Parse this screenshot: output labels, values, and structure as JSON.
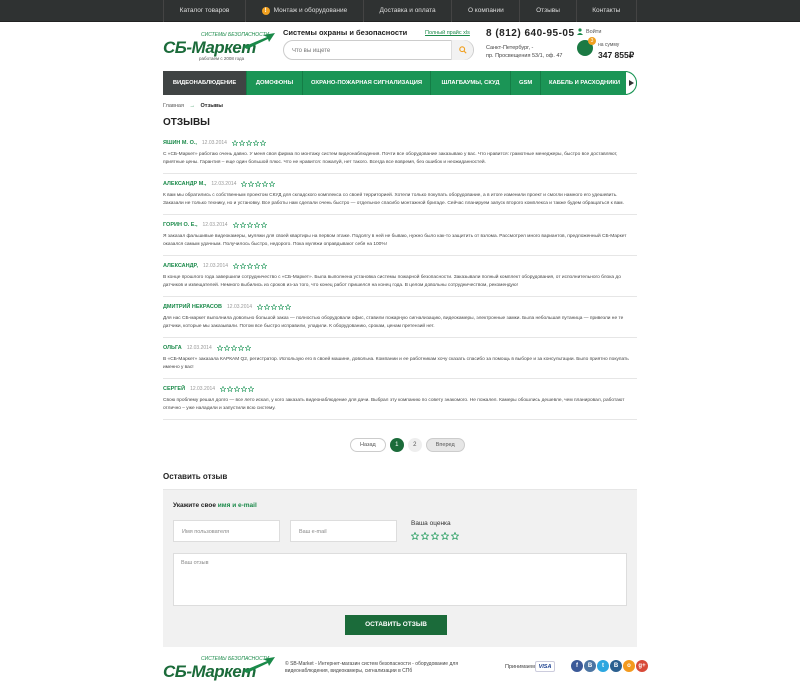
{
  "topnav": [
    {
      "label": "Каталог товаров",
      "icon": ""
    },
    {
      "label": "Монтаж и оборудование",
      "icon": "!"
    },
    {
      "label": "Доставка и оплата",
      "icon": ""
    },
    {
      "label": "О компании",
      "icon": ""
    },
    {
      "label": "Отзывы",
      "icon": ""
    },
    {
      "label": "Контакты",
      "icon": ""
    }
  ],
  "header": {
    "logo_main": "СБ-Маркет",
    "logo_top": "СИСТЕМЫ БЕЗОПАСНОСТИ",
    "logo_sub": "работаем с 2008 года",
    "tagline": "Системы охраны и безопасности",
    "price_link": "Полный прайс xls",
    "phone": "8 (812) 640-95-05",
    "address_line1": "Санкт-Петербург, -",
    "address_line2": "пр. Просвещения 53/1, оф. 47",
    "login": "Войти",
    "cart_label": "на сумму",
    "cart_sum": "347 855₽",
    "cart_count": "3"
  },
  "search": {
    "placeholder": "Что вы ищете"
  },
  "mainnav": [
    "ВИДЕОНАБЛЮДЕНИЕ",
    "ДОМОФОНЫ",
    "ОХРАНО-ПОЖАРНАЯ СИГНАЛИЗАЦИЯ",
    "ШЛАГБАУМЫ, СКУД",
    "GSM",
    "КАБЕЛЬ И РАСХОДНИКИ"
  ],
  "breadcrumb": {
    "home": "Главная",
    "sep": "→",
    "current": "Отзывы"
  },
  "page_title": "ОТЗЫВЫ",
  "reviews": [
    {
      "name": "ЯШИН М. О.,",
      "date": "12.03.2014",
      "text": "С «СБ-Маркет» работаю очень давно. У меня своя фирма по монтажу систем видеонаблюдения. Почти все оборудование заказываю у вас. Что нравится: грамотные менеджеры, быстро все доставляют, приятные цены. Гарантия – еще один большой плюс. Что не нравится: пожалуй, нет такого. Всегда все вовремя, без ошибок и неожиданностей."
    },
    {
      "name": "АЛЕКСАНДР М.,",
      "date": "12.03.2014",
      "text": "К вам мы обратились с собственным проектом СКУД для складского комплекса со своей территорией. Хотели только покупать оборудование, а в итоге изменили проект и смогли намного его удешевить. Заказали не только технику, но и установку. Все работы нам сделали очень быстро — отдельное спасибо монтажной бригаде. Сейчас планируем запуск второго комплекса и также будем обращаться к вам."
    },
    {
      "name": "ГОРИН О. Е.,",
      "date": "12.03.2014",
      "text": "Я заказал фальшивые видеокамеры, муляжи для своей квартиры на первом этаже. Подолгу в ней не бываю, нужно было как-то защитить от взлома. Рассмотрел много вариантов, предложенный СБ-Маркет оказался самым удачным. Получилось быстро, недорого. Пока муляжи оправдывают себя на 100%!"
    },
    {
      "name": "АЛЕКСАНДР,",
      "date": "12.03.2014",
      "text": "В конце прошлого года завершили сотрудничество с «СБ-Маркет». Была выполнена установка системы пожарной безопасности. Заказывали полный комплект оборудования, от исполнительного блока до датчиков и извещателей. Немного выбились из сроков из-за того, что конец работ пришелся на конец года. В целом довольны сотрудничеством, рекомендую!"
    },
    {
      "name": "ДМИТРИЙ НЕКРАСОВ",
      "date": "12.03.2014",
      "text": "Для нас СБ-маркет выполнила довольно большой заказ — полностью оборудовали офис, ставили пожарную сигнализацию, видеокамеры, электронные замки. Была небольшая путаница — привезли не те датчики, которые мы заказывали. Потом все быстро исправили, уладили. К оборудованию, срокам, ценам претензий нет."
    },
    {
      "name": "ОЛЬГА",
      "date": "12.03.2014",
      "text": "В «СБ-Маркет» заказала КАРКАМ Q2, регистратор. Использую его в своей машине, довольна. Компании и ее работникам хочу сказать спасибо за помощь в выборе и за консультации. Было приятно покупать именно у вас!"
    },
    {
      "name": "СЕРГЕЙ",
      "date": "12.03.2014",
      "text": "Свою проблему решал долго — все лето искал, у кого заказать видеонаблюдение для дачи. Выбрал эту компанию по совету знакомого. Не пожалел. Камеры обошлись дешевле, чем планировал, работают отлично – уже наладили и запустили всю систему."
    }
  ],
  "pager": {
    "prev": "Назад",
    "pages": [
      "1",
      "2"
    ],
    "next": "Вперед"
  },
  "form": {
    "heading": "Оставить отзыв",
    "subheading_prefix": "Укажите свое",
    "subheading_em": "имя и e-mail",
    "username_placeholder": "Имя пользователя",
    "email_placeholder": "Ваш e-mail",
    "rating_label": "Ваша оценка",
    "review_placeholder": "Ваш отзыв",
    "submit": "ОСТАВИТЬ ОТЗЫВ"
  },
  "footer": {
    "logo_main": "СБ-Маркет",
    "logo_top": "СИСТЕМЫ БЕЗОПАСНОСТИ",
    "copyright": "© SB-Market - Интернет-магазин систем безопасности - оборудование для видеонаблюдения, видеокамеры, сигнализации в СПб",
    "accept": "Принимаем:",
    "visa": "VISA",
    "socials": [
      {
        "name": "facebook",
        "glyph": "f",
        "color": "#3b5998"
      },
      {
        "name": "vk",
        "glyph": "В",
        "color": "#4c75a3"
      },
      {
        "name": "twitter",
        "glyph": "t",
        "color": "#2ca7e0"
      },
      {
        "name": "livejournal",
        "glyph": "B",
        "color": "#2a5f8f"
      },
      {
        "name": "odnoklassniki",
        "glyph": "о",
        "color": "#f39a1e"
      },
      {
        "name": "googleplus",
        "glyph": "g+",
        "color": "#d84a38"
      }
    ]
  },
  "colors": {
    "brand_green": "#1b9556",
    "dark_green": "#1b6b3a",
    "accent": "#f0a020",
    "topbar": "#2f3232"
  }
}
